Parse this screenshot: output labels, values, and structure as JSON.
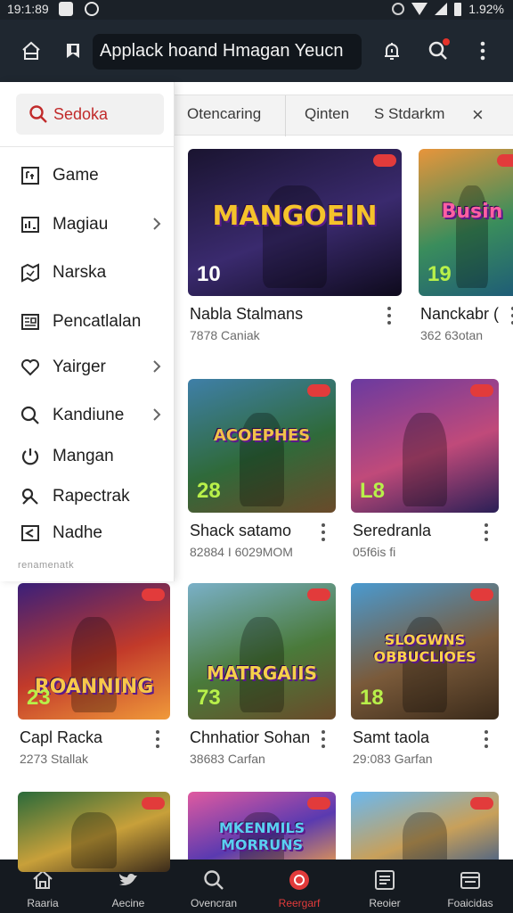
{
  "status_bar": {
    "time": "19:1:89",
    "battery": "1.92%"
  },
  "app_bar": {
    "search_text": "Applack hoand Hmagan Yeucn"
  },
  "drawer": {
    "search_label": "Sedoka",
    "items": [
      {
        "label": "Game",
        "icon": "gamepad-icon",
        "chevron": false
      },
      {
        "label": "Magiau",
        "icon": "chart-icon",
        "chevron": true
      },
      {
        "label": "Narska",
        "icon": "map-icon",
        "chevron": false
      },
      {
        "label": "Pencatlalan",
        "icon": "newspaper-icon",
        "chevron": false
      },
      {
        "label": "Yairger",
        "icon": "heart-icon",
        "chevron": true
      },
      {
        "label": "Kandiune",
        "icon": "search-icon",
        "chevron": true
      },
      {
        "label": "Mangan",
        "icon": "power-icon",
        "chevron": false
      },
      {
        "label": "Rapectrak",
        "icon": "link-icon",
        "chevron": false
      },
      {
        "label": "Nadhe",
        "icon": "share-icon",
        "chevron": false
      }
    ],
    "footer": "renamenatk"
  },
  "filters": {
    "chips": [
      "Otencaring",
      "Qinten",
      "S Stdarkm"
    ],
    "close": "×"
  },
  "games": [
    {
      "title": "Nabla Stalmans",
      "subtitle": "7878 Caniak",
      "number": "10",
      "art_text": "MANGOEIN",
      "colors": [
        "#1a1430",
        "#3a2a6e",
        "#0e0a1c"
      ],
      "art_color": "#f4c32b"
    },
    {
      "title": "Nanckabr (",
      "subtitle": "362 63otan",
      "number": "19",
      "art_text": "Busin",
      "colors": [
        "#e8953b",
        "#3a8d5c",
        "#1d5a78"
      ],
      "art_color": "#ff5fa2"
    },
    {
      "title": "Shack satamo",
      "subtitle": "82884 I 6029MOM",
      "number": "28",
      "art_text": "ACOEPHES",
      "colors": [
        "#3f7fa8",
        "#2f6a3a",
        "#6a4a2a"
      ],
      "art_color": "#f2c14a"
    },
    {
      "title": "Seredranla",
      "subtitle": "05f6is fi",
      "number": "L8",
      "art_text": "",
      "colors": [
        "#6a3aa0",
        "#c04a7a",
        "#2a1f56"
      ],
      "art_color": "#ffffff"
    },
    {
      "title": "Capl Racka",
      "subtitle": "2273 Stallak",
      "number": "23",
      "art_text": "ROANNING",
      "colors": [
        "#3a1f7a",
        "#c23a2a",
        "#f09a3a"
      ],
      "art_color": "#f7c84a"
    },
    {
      "title": "Chnhatior Sohan",
      "subtitle": "38683 Carfan",
      "number": "73",
      "art_text": "MATRGAIIS",
      "colors": [
        "#7ab0c8",
        "#4a7a3a",
        "#6a4a2a"
      ],
      "art_color": "#f5d04a"
    },
    {
      "title": "Samt taola",
      "subtitle": "29:083 Garfan",
      "number": "18",
      "art_text": "SLOGWNS OBBUCLIOES",
      "colors": [
        "#4a9ad0",
        "#7a5a3a",
        "#3a2a1a"
      ],
      "art_color": "#ffd24a"
    },
    {
      "title": "",
      "subtitle": "",
      "number": "",
      "art_text": "",
      "colors": [
        "#2a6a3a",
        "#c8a03a",
        "#3a2a1a"
      ],
      "art_color": "#ffffff"
    },
    {
      "title": "",
      "subtitle": "",
      "number": "",
      "art_text": "MKENMILS MORRUNS",
      "colors": [
        "#e05aa0",
        "#5a3ab0",
        "#f0a04a"
      ],
      "art_color": "#5ad0f0"
    },
    {
      "title": "",
      "subtitle": "",
      "number": "",
      "art_text": "",
      "colors": [
        "#6ab8f0",
        "#c8a05a",
        "#3a5a8a"
      ],
      "art_color": "#ffffff"
    }
  ],
  "bottom_nav": [
    {
      "label": "Raaria",
      "icon": "home-icon",
      "active": false
    },
    {
      "label": "Aecine",
      "icon": "bird-icon",
      "active": false
    },
    {
      "label": "Ovencran",
      "icon": "search-icon",
      "active": false
    },
    {
      "label": "Reergarf",
      "icon": "record-icon",
      "active": true
    },
    {
      "label": "Reoier",
      "icon": "list-icon",
      "active": false
    },
    {
      "label": "Foaicidas",
      "icon": "folder-icon",
      "active": false
    }
  ]
}
